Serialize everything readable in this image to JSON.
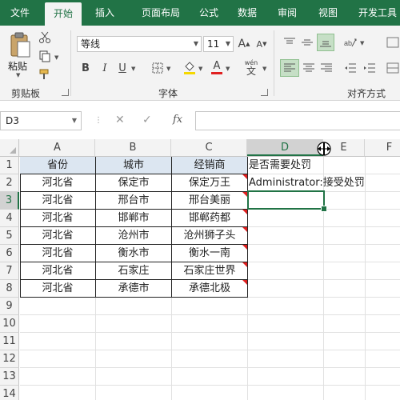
{
  "tabs": [
    "文件",
    "开始",
    "插入",
    "页面布局",
    "公式",
    "数据",
    "审阅",
    "视图",
    "开发工具"
  ],
  "active_tab": "开始",
  "clipboard": {
    "paste_label": "粘贴",
    "group_label": "剪贴板"
  },
  "font": {
    "name": "等线",
    "size": "11",
    "group_label": "字体",
    "bold": "B",
    "italic": "I",
    "underline": "U",
    "fx_symbol": "wén"
  },
  "alignment": {
    "group_label": "对齐方式"
  },
  "namebox": {
    "value": "D3"
  },
  "formula_bar": {
    "fx": "fx",
    "value": ""
  },
  "columns": [
    "A",
    "B",
    "C",
    "D",
    "E",
    "F"
  ],
  "selected_column": "D",
  "rows": [
    "1",
    "2",
    "3",
    "4",
    "5",
    "6",
    "7",
    "8",
    "9",
    "10",
    "11",
    "12",
    "13",
    "14"
  ],
  "selected_row": "3",
  "table": {
    "headers": [
      "省份",
      "城市",
      "经销商"
    ],
    "rows": [
      [
        "河北省",
        "保定市",
        "保定万王"
      ],
      [
        "河北省",
        "邢台市",
        "邢台美丽"
      ],
      [
        "河北省",
        "邯郸市",
        "邯郸药都"
      ],
      [
        "河北省",
        "沧州市",
        "沧州狮子头"
      ],
      [
        "河北省",
        "衡水市",
        "衡水一南"
      ],
      [
        "河北省",
        "石家庄",
        "石家庄世界"
      ],
      [
        "河北省",
        "承德市",
        "承德北极"
      ]
    ]
  },
  "d1_text": "是否需要处罚",
  "d2_text": "Administrator:接受处罚",
  "colors": {
    "accent": "#217346",
    "header_fill": "#dce6f1",
    "comment_marker": "#e02020"
  }
}
